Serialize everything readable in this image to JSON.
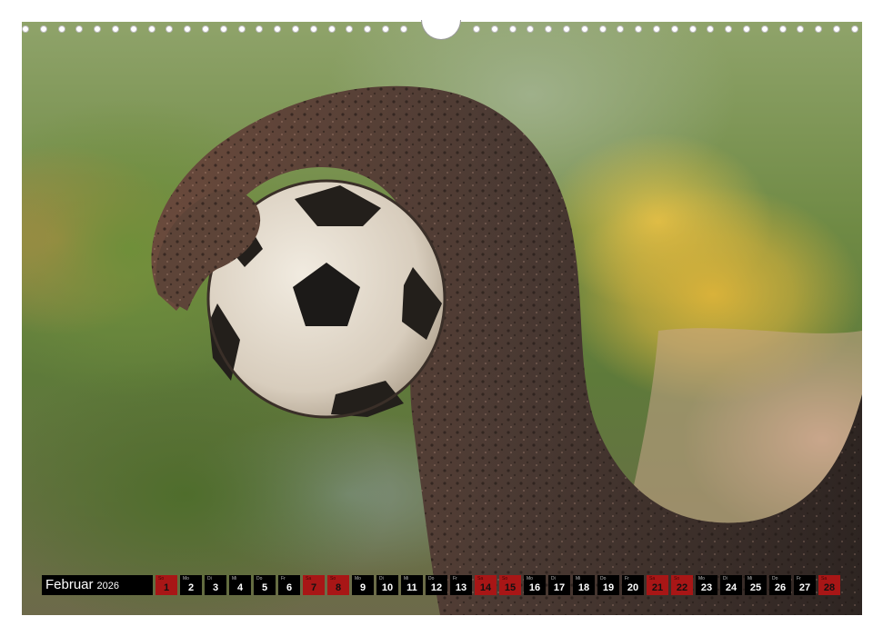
{
  "calendar": {
    "month": "Februar",
    "year": "2026",
    "days": [
      {
        "wd": "So",
        "num": "1",
        "red": true
      },
      {
        "wd": "Mo",
        "num": "2",
        "red": false
      },
      {
        "wd": "Di",
        "num": "3",
        "red": false
      },
      {
        "wd": "Mi",
        "num": "4",
        "red": false
      },
      {
        "wd": "Do",
        "num": "5",
        "red": false
      },
      {
        "wd": "Fr",
        "num": "6",
        "red": false
      },
      {
        "wd": "Sa",
        "num": "7",
        "red": true
      },
      {
        "wd": "So",
        "num": "8",
        "red": true
      },
      {
        "wd": "Mo",
        "num": "9",
        "red": false
      },
      {
        "wd": "Di",
        "num": "10",
        "red": false
      },
      {
        "wd": "Mi",
        "num": "11",
        "red": false
      },
      {
        "wd": "Do",
        "num": "12",
        "red": false
      },
      {
        "wd": "Fr",
        "num": "13",
        "red": false
      },
      {
        "wd": "Sa",
        "num": "14",
        "red": true
      },
      {
        "wd": "So",
        "num": "15",
        "red": true
      },
      {
        "wd": "Mo",
        "num": "16",
        "red": false
      },
      {
        "wd": "Di",
        "num": "17",
        "red": false
      },
      {
        "wd": "Mi",
        "num": "18",
        "red": false
      },
      {
        "wd": "Do",
        "num": "19",
        "red": false
      },
      {
        "wd": "Fr",
        "num": "20",
        "red": false
      },
      {
        "wd": "Sa",
        "num": "21",
        "red": true
      },
      {
        "wd": "So",
        "num": "22",
        "red": true
      },
      {
        "wd": "Mo",
        "num": "23",
        "red": false
      },
      {
        "wd": "Di",
        "num": "24",
        "red": false
      },
      {
        "wd": "Mi",
        "num": "25",
        "red": false
      },
      {
        "wd": "Do",
        "num": "26",
        "red": false
      },
      {
        "wd": "Fr",
        "num": "27",
        "red": false
      },
      {
        "wd": "Sa",
        "num": "28",
        "red": true
      }
    ]
  },
  "colors": {
    "weekday_bg": "#000000",
    "weekend_bg": "#a81616",
    "weekday_text": "#ffffff"
  }
}
